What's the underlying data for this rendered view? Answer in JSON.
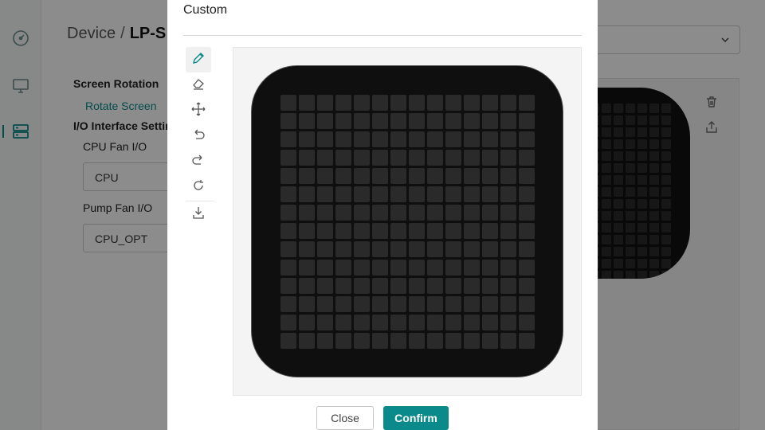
{
  "breadcrumb": {
    "root": "Device",
    "separator": "/",
    "current": "LP-S"
  },
  "settings": {
    "screen_rotation_label": "Screen Rotation",
    "rotate_screen_link": "Rotate Screen",
    "io_interface_label": "I/O Interface Settin",
    "cpu_fan_label": "CPU Fan I/O",
    "cpu_fan_value": "CPU",
    "pump_fan_label": "Pump Fan I/O",
    "pump_fan_value": "CPU_OPT"
  },
  "sidebar": {
    "items": [
      {
        "icon": "dashboard-gauge-icon"
      },
      {
        "icon": "monitor-icon"
      },
      {
        "icon": "device-list-icon",
        "active": true
      }
    ]
  },
  "modal": {
    "title": "Custom",
    "tools": [
      {
        "icon": "pencil-icon",
        "active": true
      },
      {
        "icon": "eraser-icon"
      },
      {
        "icon": "move-icon"
      },
      {
        "icon": "undo-icon"
      },
      {
        "icon": "redo-icon"
      },
      {
        "icon": "reset-icon"
      },
      {
        "icon": "download-icon"
      }
    ],
    "grid": {
      "columns": 14,
      "rows": 14
    },
    "close_label": "Close",
    "confirm_label": "Confirm"
  },
  "colors": {
    "accent": "#0a8a8a",
    "screen_bg": "#0f0f0f",
    "pixel_off": "#2a2a2a"
  }
}
